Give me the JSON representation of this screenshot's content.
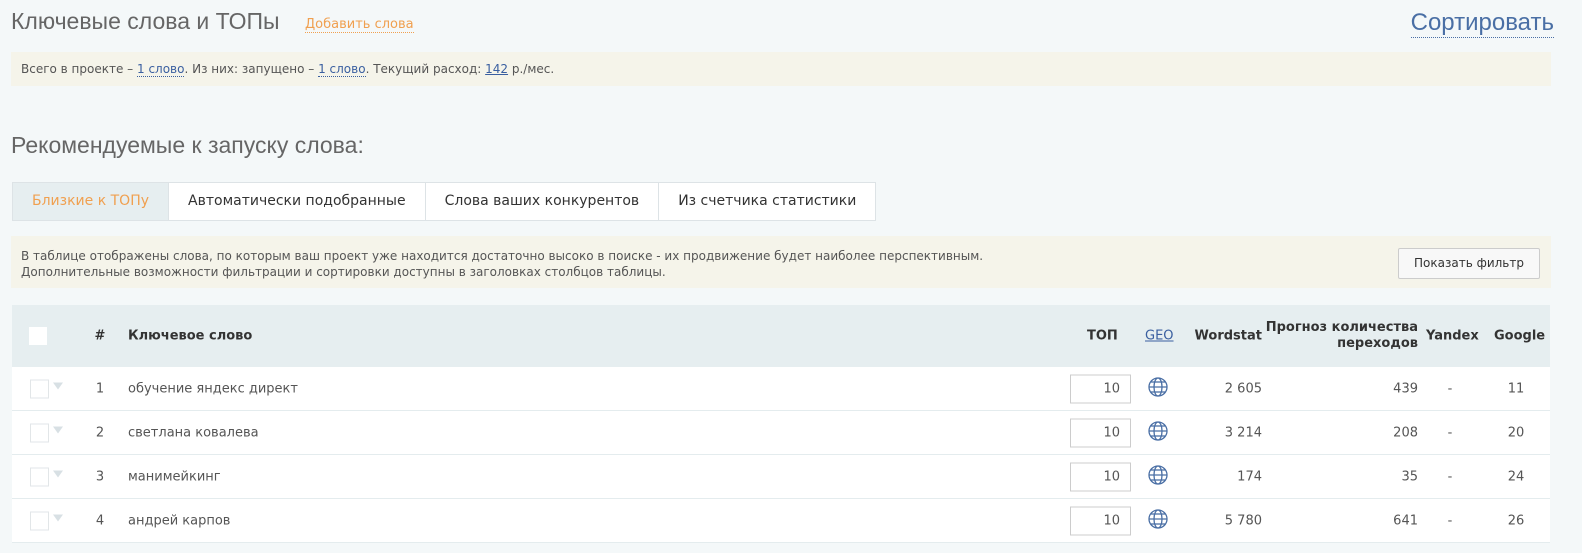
{
  "header": {
    "title": "Ключевые слова и ТОПы",
    "add_words": "Добавить слова",
    "sort": "Сортировать"
  },
  "summary": {
    "p1": "Всего в проекте – ",
    "total": "1 слово",
    "p2": ". Из них: запущено – ",
    "launched": "1 слово",
    "p3": ". Текущий расход: ",
    "spend": "142",
    "p4": " р./мес."
  },
  "recommended_title": "Рекомендуемые к запуску слова:",
  "tabs": [
    {
      "label": "Близкие к ТОПу"
    },
    {
      "label": "Автоматически подобранные"
    },
    {
      "label": "Слова ваших конкурентов"
    },
    {
      "label": "Из счетчика статистики"
    }
  ],
  "info": {
    "line1": "В таблице отображены слова, по которым ваш проект уже находится достаточно высоко в поиске - их продвижение будет наиболее перспективным.",
    "line2": "Дополнительные возможности фильтрации и сортировки доступны в заголовках столбцов таблицы.",
    "filter_button": "Показать фильтр"
  },
  "table": {
    "columns": {
      "num": "#",
      "keyword": "Ключевое слово",
      "top": "ТОП",
      "geo": "GEO",
      "wordstat": "Wordstat",
      "forecast1": "Прогноз количества",
      "forecast2": "переходов",
      "yandex": "Yandex",
      "google": "Google"
    },
    "rows": [
      {
        "num": "1",
        "keyword": "обучение яндекс директ",
        "top": "10",
        "wordstat": "2 605",
        "forecast": "439",
        "yandex": "-",
        "google": "11"
      },
      {
        "num": "2",
        "keyword": "светлана ковалева",
        "top": "10",
        "wordstat": "3 214",
        "forecast": "208",
        "yandex": "-",
        "google": "20"
      },
      {
        "num": "3",
        "keyword": "манимейкинг",
        "top": "10",
        "wordstat": "174",
        "forecast": "35",
        "yandex": "-",
        "google": "24"
      },
      {
        "num": "4",
        "keyword": "андрей карпов",
        "top": "10",
        "wordstat": "5 780",
        "forecast": "641",
        "yandex": "-",
        "google": "26"
      }
    ]
  }
}
